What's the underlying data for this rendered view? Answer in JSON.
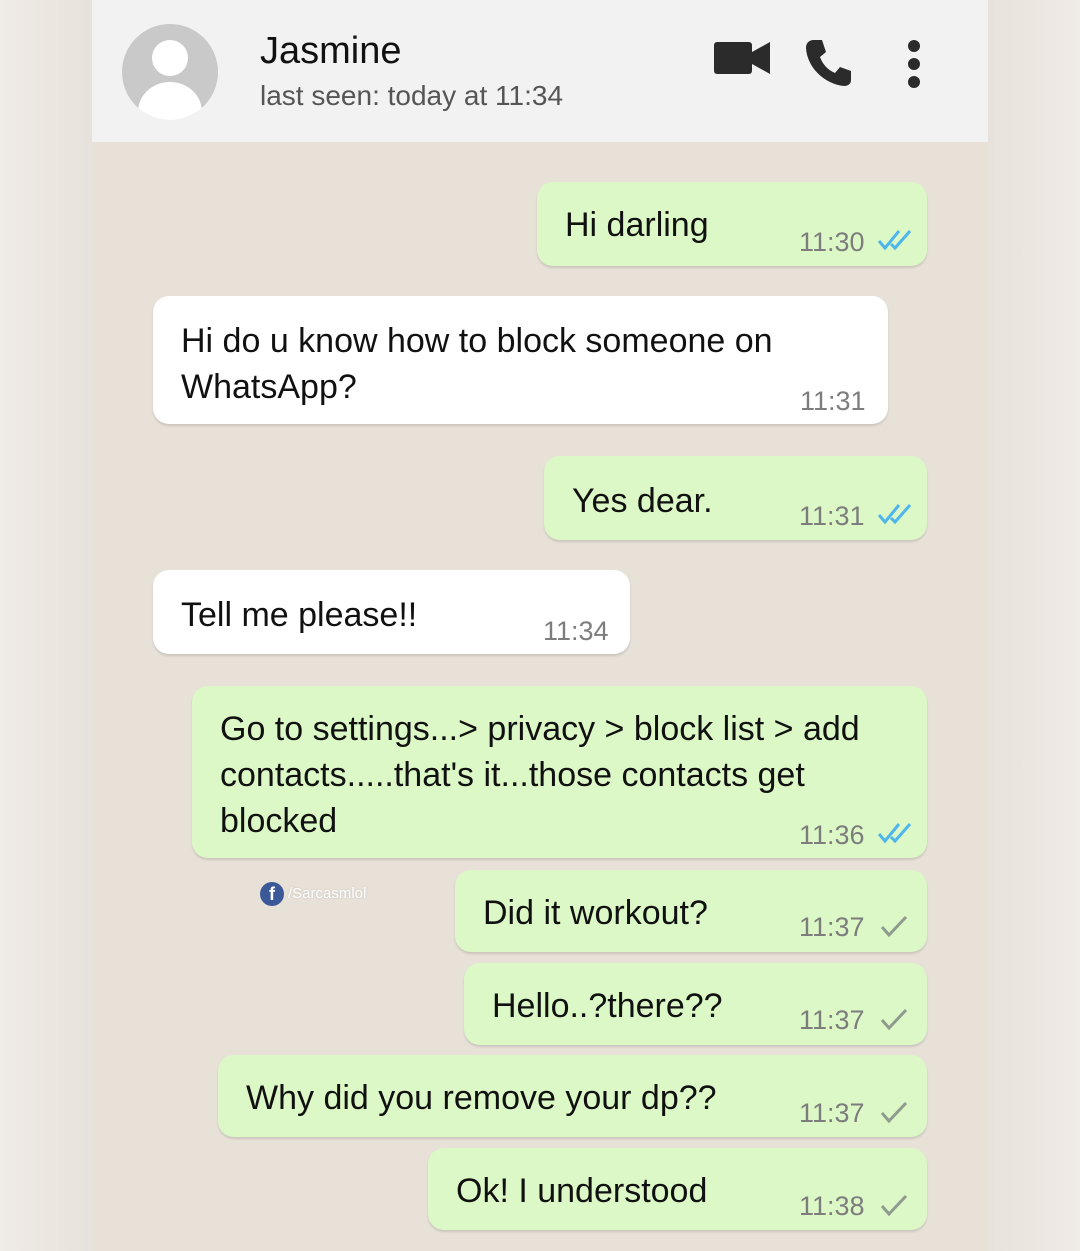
{
  "header": {
    "name": "Jasmine",
    "status": "last seen: today at 11:34"
  },
  "icons": {
    "video": "video-camera-icon",
    "call": "phone-icon",
    "menu": "more-vertical-icon",
    "avatar": "default-avatar-icon"
  },
  "colors": {
    "outgoing_bubble": "#dcf8c6",
    "incoming_bubble": "#ffffff",
    "read_ticks": "#4fb6ec",
    "sent_ticks": "#8e9b8e",
    "chat_background": "#e7e1d8"
  },
  "messages": [
    {
      "direction": "outgoing",
      "text": "Hi darling",
      "time": "11:30",
      "status": "read"
    },
    {
      "direction": "incoming",
      "text": "Hi do u know how to block someone on\nWhatsApp?",
      "time": "11:31"
    },
    {
      "direction": "outgoing",
      "text": "Yes dear.",
      "time": "11:31",
      "status": "read"
    },
    {
      "direction": "incoming",
      "text": "Tell me please!!",
      "time": "11:34"
    },
    {
      "direction": "outgoing",
      "text": "Go to settings...> privacy > block list > add\ncontacts.....that's it...those contacts get\nblocked",
      "time": "11:36",
      "status": "read"
    },
    {
      "direction": "outgoing",
      "text": "Did it workout?",
      "time": "11:37",
      "status": "sent"
    },
    {
      "direction": "outgoing",
      "text": "Hello..?there??",
      "time": "11:37",
      "status": "sent"
    },
    {
      "direction": "outgoing",
      "text": "Why did you remove your dp??",
      "time": "11:37",
      "status": "sent"
    },
    {
      "direction": "outgoing",
      "text": "Ok! I understood",
      "time": "11:38",
      "status": "sent"
    }
  ],
  "watermark": {
    "icon": "facebook-icon",
    "text": "/Sarcasmlol"
  }
}
